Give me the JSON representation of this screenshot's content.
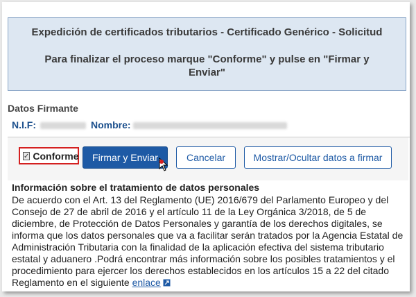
{
  "header": {
    "title": "Expedición de certificados tributarios - Certificado Genérico - Solicitud",
    "message": "Para finalizar el proceso marque \"Conforme\" y pulse en \"Firmar y Enviar\""
  },
  "signer": {
    "section_title": "Datos Firmante",
    "nif_label": "N.I.F:",
    "name_label": "Nombre:"
  },
  "actions": {
    "conforme_label": "Conforme",
    "conforme_checked": true,
    "sign_send_label": "Firmar y Enviar",
    "cancel_label": "Cancelar",
    "toggle_data_label": "Mostrar/Ocultar datos a firmar"
  },
  "info": {
    "title": "Información sobre el tratamiento de datos personales",
    "body": "De acuerdo con el Art. 13 del Reglamento (UE) 2016/679 del Parlamento Europeo y del Consejo de 27 de abril de 2016 y el artículo 11 de la Ley Orgánica 3/2018, de 5 de diciembre, de Protección de Datos Personales y garantía de los derechos digitales, se informa que los datos personales que va a facilitar serán tratados por la Agencia Estatal de Administración Tributaria con la finalidad de la aplicación efectiva del sistema tributario estatal y aduanero .Podrá encontrar más información sobre los posibles tratamientos y el procedimiento para ejercer los derechos establecidos en los artículos 15 a 22 del citado Reglamento en el siguiente",
    "link_label": "enlace"
  },
  "icons": {
    "external_link": "external-link-icon",
    "cursor": "mouse-cursor-icon"
  },
  "colors": {
    "header_bg": "#dde7f2",
    "primary": "#1e5aa5",
    "highlight": "#d42020"
  }
}
